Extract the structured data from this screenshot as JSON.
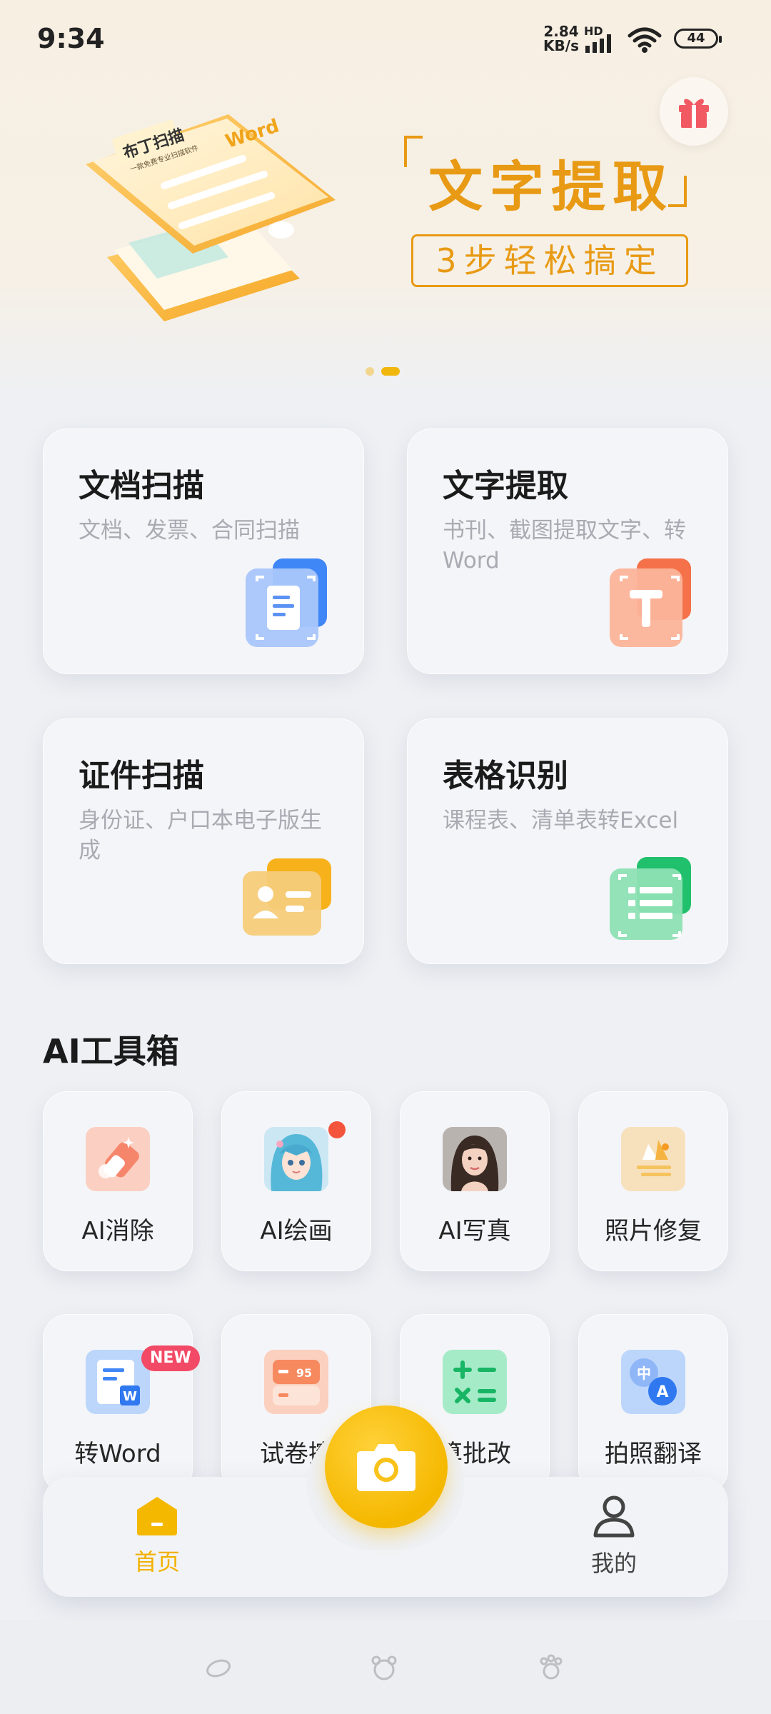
{
  "status_bar": {
    "time": "9:34",
    "net_speed_value": "2.84",
    "net_speed_unit": "KB/s",
    "network_type": "HD",
    "battery": "44"
  },
  "banner": {
    "illustration_text_1": "布丁扫描",
    "illustration_text_2": "一款免费专业扫描软件",
    "illustration_text_3": "Word",
    "title": "文字提取",
    "subtitle": "3步轻松搞定",
    "page_indicator": {
      "count": 2,
      "active_index": 1
    }
  },
  "features": [
    {
      "title": "文档扫描",
      "desc": "文档、发票、合同扫描",
      "icon": "document-scan-icon"
    },
    {
      "title": "文字提取",
      "desc": "书刊、截图提取文字、转Word",
      "icon": "text-extract-icon"
    },
    {
      "title": "证件扫描",
      "desc": "身份证、户口本电子版生成",
      "icon": "id-card-icon"
    },
    {
      "title": "表格识别",
      "desc": "课程表、清单表转Excel",
      "icon": "table-recognition-icon"
    }
  ],
  "ai_toolbox": {
    "title": "AI工具箱",
    "tools": [
      {
        "label": "AI消除",
        "icon": "eraser-icon"
      },
      {
        "label": "AI绘画",
        "icon": "anime-portrait-icon"
      },
      {
        "label": "AI写真",
        "icon": "portrait-photo-icon"
      },
      {
        "label": "照片修复",
        "icon": "photo-restore-icon"
      },
      {
        "label": "转Word",
        "icon": "word-icon",
        "badge": "NEW"
      },
      {
        "label": "试卷擦",
        "icon": "exam-erase-icon"
      },
      {
        "label": "算批改",
        "icon": "math-check-icon"
      },
      {
        "label": "拍照翻译",
        "icon": "translate-icon"
      }
    ]
  },
  "bottom_nav": {
    "home_label": "首页",
    "mine_label": "我的",
    "camera": "camera-icon"
  },
  "colors": {
    "accent": "#f5b800",
    "banner_orange": "#e89a14",
    "badge_red": "#f24a66"
  }
}
